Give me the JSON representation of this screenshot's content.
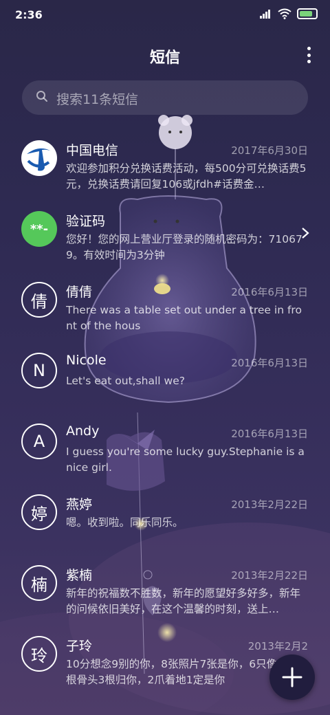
{
  "status_bar": {
    "time": "2:36"
  },
  "header": {
    "title": "短信"
  },
  "search": {
    "placeholder": "搜索11条短信"
  },
  "conversations": [
    {
      "name": "中国电信",
      "date": "2017年6月30日",
      "preview": "欢迎参加积分兑换话费活动，每500分可兑换话费5元，兑换话费请回复106或jfdh#话费金…",
      "avatar": "china-telecom-logo"
    },
    {
      "name": "验证码",
      "date": "",
      "preview": "您好！您的网上营业厅登录的随机密码为：710679。有效时间为3分钟",
      "avatar": "**-"
    },
    {
      "name": "倩倩",
      "date": "2016年6月13日",
      "preview": "There was a table set out under a tree in front of the hous",
      "avatar": "倩"
    },
    {
      "name": "Nicole",
      "date": "2016年6月13日",
      "preview": "Let's eat out,shall we?",
      "avatar": "N"
    },
    {
      "name": "Andy",
      "date": "2016年6月13日",
      "preview": "I guess you're some lucky guy.Stephanie is a nice girl.",
      "avatar": "A"
    },
    {
      "name": "燕婷",
      "date": "2013年2月22日",
      "preview": "嗯。收到啦。同乐同乐。",
      "avatar": "婷"
    },
    {
      "name": "紫楠",
      "date": "2013年2月22日",
      "preview": "新年的祝福数不胜数，新年的愿望好多好多，新年的问候依旧美好，在这个温馨的时刻，送上…",
      "avatar": "楠"
    },
    {
      "name": "子玲",
      "date": "2013年2月2",
      "preview": "10分想念9别的你，8张照片7张是你，6只像你，4根骨头3根归你，2爪着地1定是你",
      "avatar": "玲"
    }
  ],
  "fab": {
    "icon": "plus-icon"
  },
  "colors": {
    "background": "#2e2a52",
    "accent_green": "#55c85a",
    "telecom_blue": "#1a5bb0"
  }
}
